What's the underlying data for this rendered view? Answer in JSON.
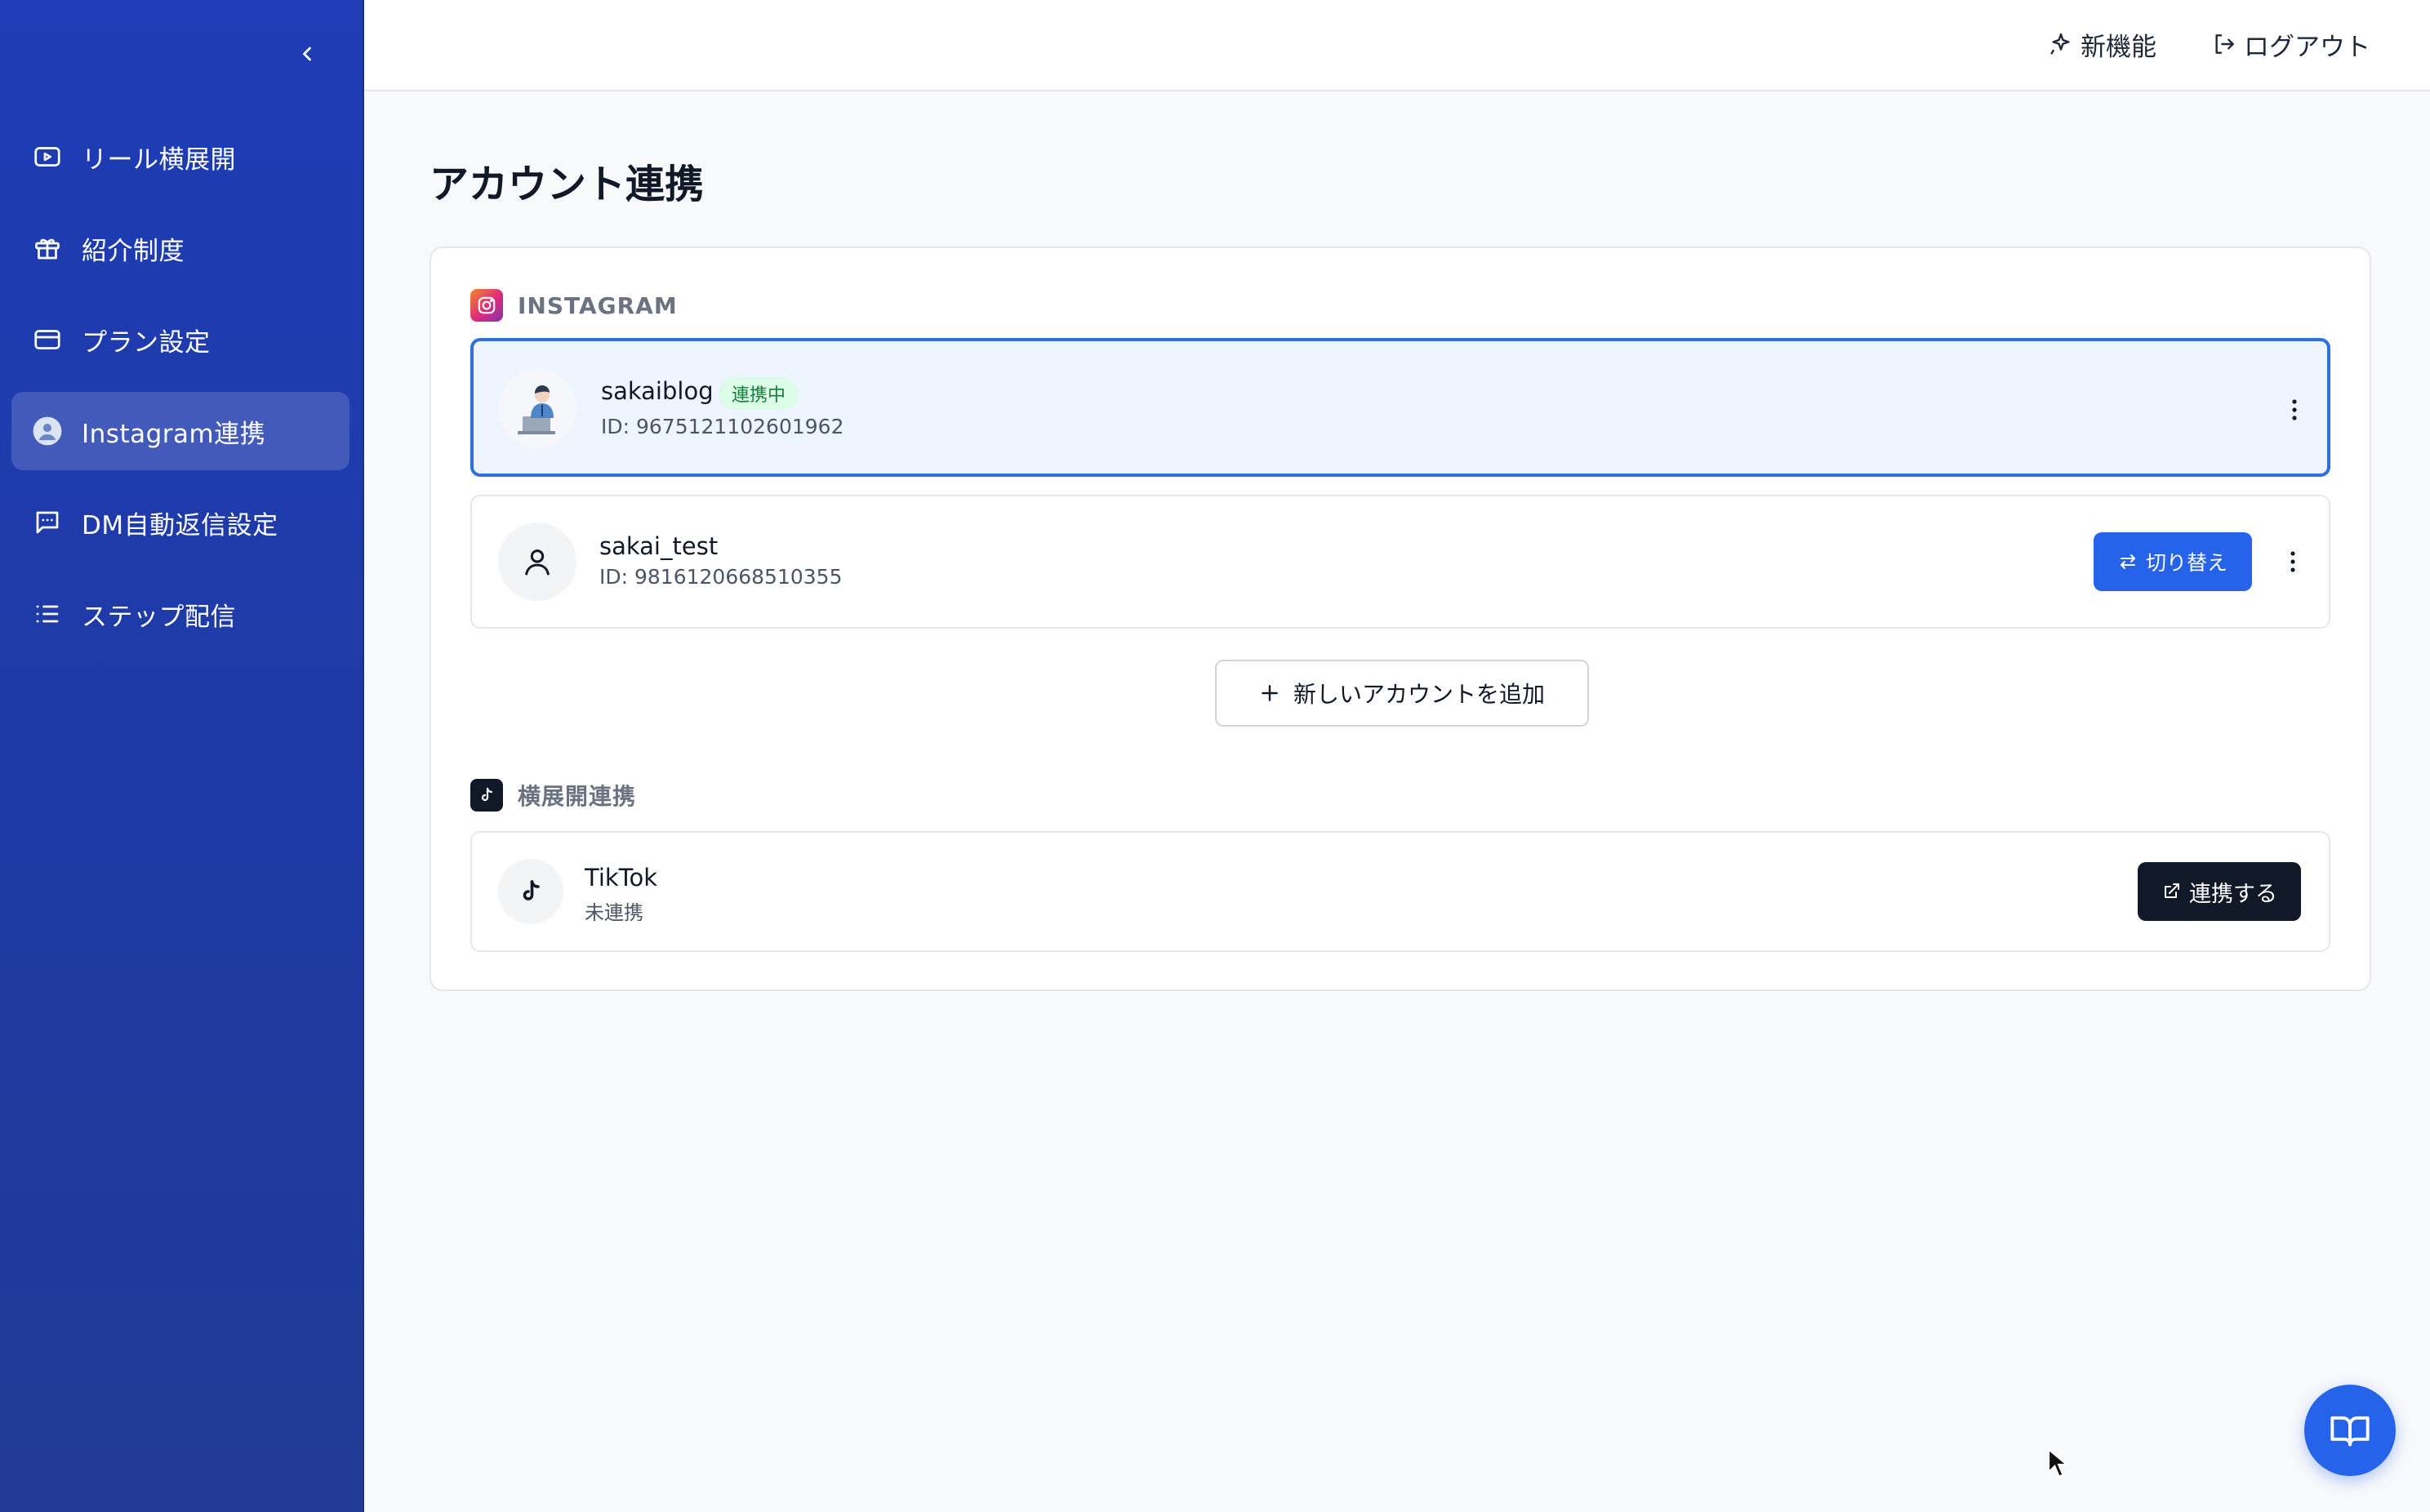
{
  "sidebar": {
    "items": [
      {
        "label": "リール横展開",
        "icon": "play-video-icon"
      },
      {
        "label": "紹介制度",
        "icon": "gift-icon"
      },
      {
        "label": "プラン設定",
        "icon": "credit-card-icon"
      },
      {
        "label": "Instagram連携",
        "icon": "avatar-icon",
        "active": true
      },
      {
        "label": "DM自動返信設定",
        "icon": "message-icon"
      },
      {
        "label": "ステップ配信",
        "icon": "list-icon"
      }
    ]
  },
  "topbar": {
    "new_features": "新機能",
    "logout": "ログアウト"
  },
  "page": {
    "title": "アカウント連携"
  },
  "instagram": {
    "section_label": "INSTAGRAM",
    "accounts": [
      {
        "name": "sakaiblog",
        "id": "ID: 9675121102601962",
        "badge": "連携中",
        "selected": true
      },
      {
        "name": "sakai_test",
        "id": "ID: 9816120668510355",
        "switch_label": "切り替え"
      }
    ],
    "add_account_label": "新しいアカウントを追加"
  },
  "cross_post": {
    "section_label": "横展開連携",
    "services": [
      {
        "name": "TikTok",
        "status": "未連携",
        "connect_label": "連携する"
      }
    ]
  },
  "colors": {
    "sidebar": "#1f3aa4",
    "accent": "#2563eb",
    "selected_border": "#2f6fe0",
    "selected_bg": "#eef5ff",
    "badge_bg": "#dcfce7",
    "badge_text": "#15803d",
    "dark_button": "#111827"
  }
}
